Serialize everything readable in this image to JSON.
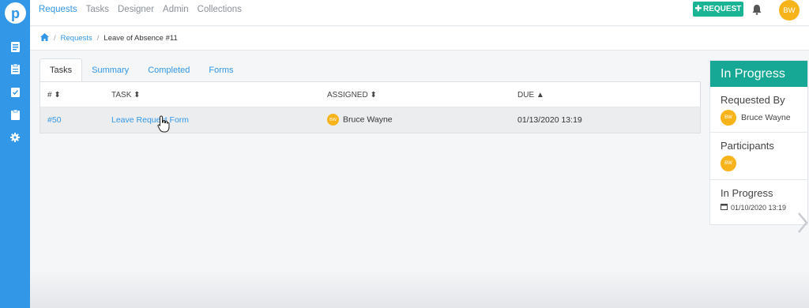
{
  "nav": {
    "items": [
      "Requests",
      "Tasks",
      "Designer",
      "Admin",
      "Collections"
    ],
    "request_button": "REQUEST",
    "user_initials": "BW"
  },
  "breadcrumb": {
    "link": "Requests",
    "separator": "/",
    "current": "Leave of Absence #11"
  },
  "tabs": [
    "Tasks",
    "Summary",
    "Completed",
    "Forms"
  ],
  "table": {
    "headers": [
      "#",
      "TASK",
      "ASSIGNED",
      "DUE"
    ],
    "rows": [
      {
        "id": "#50",
        "task": "Leave Request Form",
        "assigned_initials": "BW",
        "assigned": "Bruce Wayne",
        "due": "01/13/2020 13:19"
      }
    ]
  },
  "panel": {
    "status": "In Progress",
    "requested_by_label": "Requested By",
    "requested_by_initials": "BW",
    "requested_by_name": "Bruce Wayne",
    "participants_label": "Participants",
    "participant_initials": "BW",
    "in_progress_label": "In Progress",
    "in_progress_date": "01/10/2020 13:19"
  },
  "colors": {
    "sidebar": "#3397e8",
    "accent": "#1ab394",
    "status_header": "#16a894",
    "avatar": "#f7b31a"
  },
  "icons": [
    "logo-icon",
    "requests-icon",
    "tasks-icon",
    "checklist-icon",
    "clipboard-icon",
    "gear-icon",
    "home-icon",
    "bell-icon",
    "plus-icon",
    "sort-icon",
    "calendar-icon",
    "chevron-right-icon",
    "hand-cursor-icon"
  ]
}
